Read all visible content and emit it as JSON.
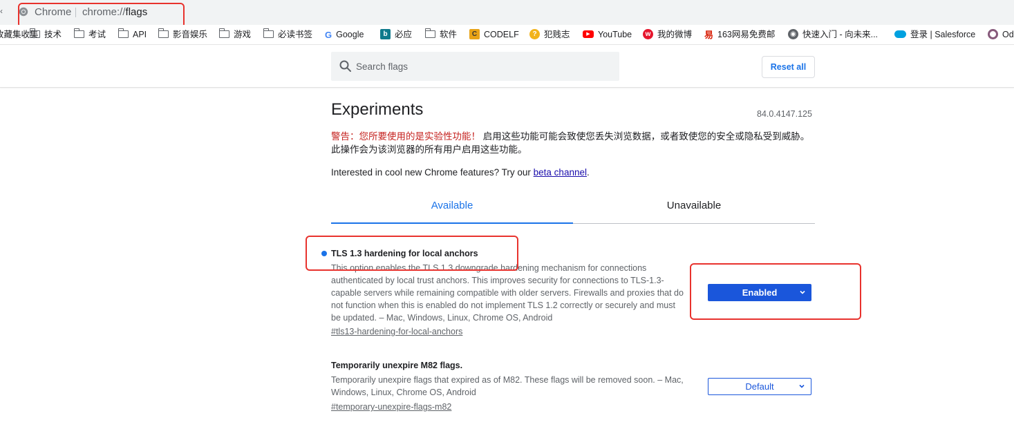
{
  "address_bar": {
    "back_glyph": "‹",
    "site_name": "Chrome",
    "url_prefix": "chrome://",
    "url_path": "flags"
  },
  "bookmarks": [
    {
      "label": "收藏集收集",
      "icon": "folder-icon"
    },
    {
      "label": "技术",
      "icon": "folder-icon"
    },
    {
      "label": "考试",
      "icon": "folder-icon"
    },
    {
      "label": "API",
      "icon": "folder-icon"
    },
    {
      "label": "影音娱乐",
      "icon": "folder-icon"
    },
    {
      "label": "游戏",
      "icon": "folder-icon"
    },
    {
      "label": "必读书签",
      "icon": "folder-icon"
    },
    {
      "label": "Google",
      "icon": "google-icon"
    },
    {
      "label": "必应",
      "icon": "bing-icon"
    },
    {
      "label": "软件",
      "icon": "folder-icon"
    },
    {
      "label": "CODELF",
      "icon": "codelf-icon"
    },
    {
      "label": "犯贱志",
      "icon": "fanjianzhi-icon"
    },
    {
      "label": "YouTube",
      "icon": "youtube-icon"
    },
    {
      "label": "我的微博",
      "icon": "weibo-icon"
    },
    {
      "label": "163网易免费邮",
      "icon": "netease-icon"
    },
    {
      "label": "快速入门 - 向未来...",
      "icon": "globe-icon"
    },
    {
      "label": "登录 | Salesforce",
      "icon": "salesforce-icon"
    },
    {
      "label": "Od",
      "icon": "odoo-icon"
    }
  ],
  "header": {
    "search_placeholder": "Search flags",
    "reset_label": "Reset all"
  },
  "content": {
    "title": "Experiments",
    "version": "84.0.4147.125",
    "warning_red": "警告：您所要使用的是实验性功能！",
    "warning_rest": " 启用这些功能可能会致使您丢失浏览数据，或者致使您的安全或隐私受到威胁。此操作会为该浏览器的所有用户启用这些功能。",
    "interested_text": "Interested in cool new Chrome features? Try our ",
    "beta_link": "beta channel",
    "interested_end": "."
  },
  "tabs": [
    {
      "label": "Available",
      "active": true
    },
    {
      "label": "Unavailable",
      "active": false
    }
  ],
  "flags": [
    {
      "title": "TLS 1.3 hardening for local anchors",
      "desc_lines": [
        "This option enables the TLS 1.3 downgrade hardening mechanism for connections",
        "authenticated by local trust anchors. This improves security for connections to TLS-1.3-",
        "capable servers while remaining compatible with older servers. Firewalls and proxies that do",
        "not function when this is enabled do not implement TLS 1.2 correctly or securely and must",
        "be updated. – Mac, Windows, Linux, Chrome OS, Android"
      ],
      "link": "#tls13-hardening-for-local-anchors",
      "state": "Enabled",
      "modified": true
    },
    {
      "title": "Temporarily unexpire M82 flags.",
      "desc_lines": [
        "Temporarily unexpire flags that expired as of M82. These flags will be removed soon. – Mac,",
        "Windows, Linux, Chrome OS, Android"
      ],
      "link": "#temporary-unexpire-flags-m82",
      "state": "Default",
      "modified": false
    }
  ],
  "colors": {
    "accent_blue": "#1a73e8",
    "select_blue": "#1a56db",
    "warning_red": "#c5221f",
    "annotation_red": "#e8322d"
  }
}
